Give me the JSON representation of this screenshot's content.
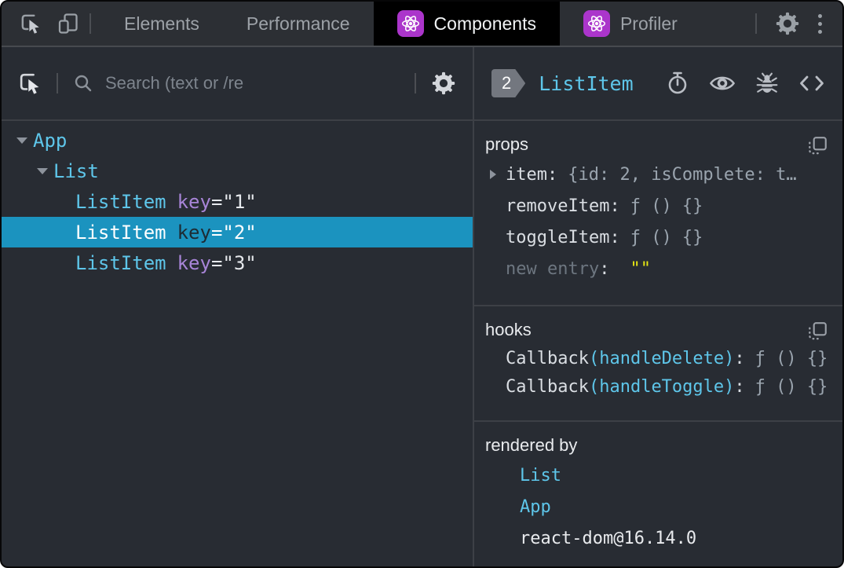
{
  "topbar": {
    "tabs": [
      {
        "label": "Elements",
        "active": false
      },
      {
        "label": "Performance",
        "active": false
      },
      {
        "label": "Components",
        "active": true
      },
      {
        "label": "Profiler",
        "active": false
      }
    ]
  },
  "left_panel": {
    "search_placeholder": "Search (text or /re",
    "tree": {
      "rows": [
        {
          "name": "App",
          "depth": 0,
          "expanded": true
        },
        {
          "name": "List",
          "depth": 1,
          "expanded": true
        },
        {
          "name": "ListItem",
          "attr": "key",
          "value": "=\"1\"",
          "depth": 2,
          "selected": false
        },
        {
          "name": "ListItem",
          "attr": "key",
          "value": "=\"2\"",
          "depth": 2,
          "selected": true
        },
        {
          "name": "ListItem",
          "attr": "key",
          "value": "=\"3\"",
          "depth": 2,
          "selected": false
        }
      ]
    }
  },
  "right_panel": {
    "header": {
      "badge": "2",
      "component": "ListItem"
    },
    "props": {
      "title": "props",
      "rows": [
        {
          "name": "item:",
          "value": "{id: 2, isComplete: t…",
          "expandable": true
        },
        {
          "name": "removeItem:",
          "value": "ƒ () {}"
        },
        {
          "name": "toggleItem:",
          "value": "ƒ () {}"
        },
        {
          "name": "new entry",
          "colon": ":",
          "value": "\"\""
        }
      ]
    },
    "hooks": {
      "title": "hooks",
      "rows": [
        {
          "fn": "Callback",
          "name": "(handleDelete)",
          "colon": ":",
          "value": "ƒ () {}"
        },
        {
          "fn": "Callback",
          "name": "(handleToggle)",
          "colon": ":",
          "value": "ƒ () {}"
        }
      ]
    },
    "rendered_by": {
      "title": "rendered by",
      "links": [
        {
          "label": "List"
        },
        {
          "label": "App"
        }
      ],
      "runtime": "react-dom@16.14.0"
    }
  },
  "icons": {
    "topbar": [
      "inspect-element-icon",
      "device-toolbar-icon",
      "react-logo-icon",
      "settings-gear-icon",
      "kebab-menu-icon"
    ],
    "left_toolbar": [
      "inspect-component-icon",
      "search-icon",
      "settings-gear-icon"
    ],
    "right_header": [
      "suspense-stopwatch-icon",
      "inspect-dom-eye-icon",
      "debug-bug-icon",
      "view-source-code-icon"
    ],
    "sections": [
      "copy-icon"
    ]
  },
  "colors": {
    "panel_bg": "#282c33",
    "topbar_bg": "#2c2f34",
    "active_tab_bg": "#000000",
    "component_cyan": "#5ec6ea",
    "attr_purple": "#a885d8",
    "selected_row_blue": "#1b93bf",
    "value_gray": "#9aa4ae",
    "empty_string_yellow": "#e9e914",
    "react_icon_purple": "#ab35cb",
    "badge_gray": "#73777f"
  }
}
